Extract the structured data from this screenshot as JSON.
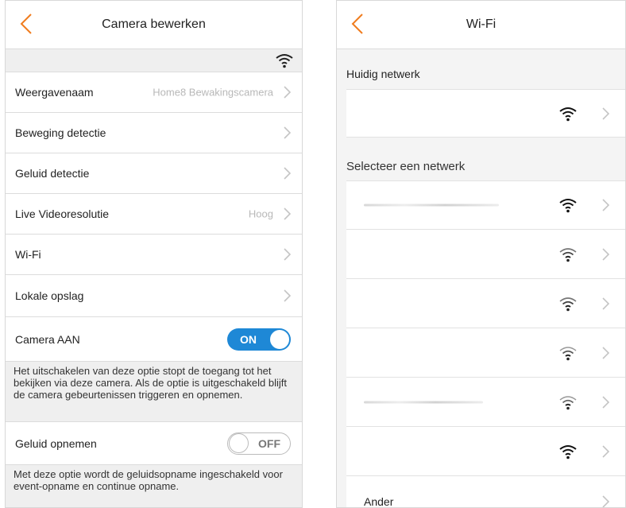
{
  "left_screen": {
    "title": "Camera bewerken",
    "back_icon": "chevron-left-icon",
    "rows": [
      {
        "label": "Weergavenaam",
        "value": "Home8 Bewakingscamera"
      },
      {
        "label": "Beweging detectie",
        "value": ""
      },
      {
        "label": "Geluid detectie",
        "value": ""
      },
      {
        "label": "Live Videoresolutie",
        "value": "Hoog"
      },
      {
        "label": "Wi-Fi",
        "value": ""
      },
      {
        "label": "Lokale opslag",
        "value": ""
      }
    ],
    "camera_toggle": {
      "label": "Camera AAN",
      "state": "ON",
      "on": true
    },
    "camera_note": "Het uitschakelen van deze optie stopt de toegang tot het bekijken via deze camera. Als de optie is uitgeschakeld blijft de camera gebeurtenissen triggeren en opnemen.",
    "audio_toggle": {
      "label": "Geluid opnemen",
      "state": "OFF",
      "on": false
    },
    "audio_note": "Met deze optie wordt de geluidsopname ingeschakeld voor event-opname en continue opname."
  },
  "right_screen": {
    "title": "Wi-Fi",
    "back_icon": "chevron-left-icon",
    "current_header": "Huidig netwerk",
    "select_header": "Selecteer een netwerk",
    "networks_count_visible": 6,
    "other_label": "Ander"
  },
  "colors": {
    "accent_orange": "#f07c1e",
    "toggle_blue": "#1e88d6",
    "muted_text": "#b8b8b8"
  }
}
